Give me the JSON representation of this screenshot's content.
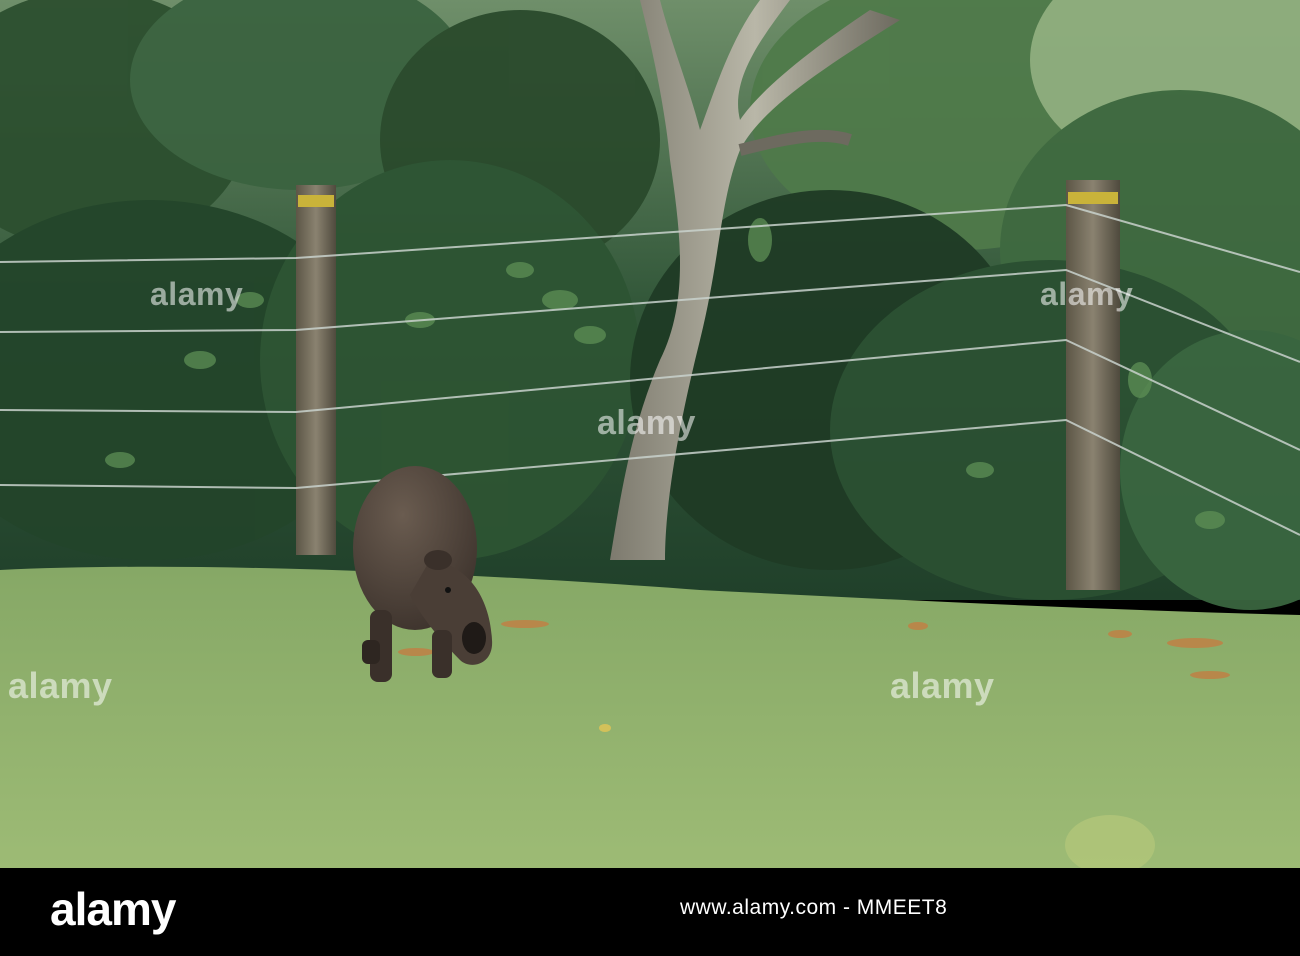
{
  "watermark": {
    "brand": "alamy",
    "overlay_text": "alamy"
  },
  "footer": {
    "logo_text": "alamy",
    "id_text": "www.alamy.com - MMEET8"
  },
  "colors": {
    "lawn": "#8fb06a",
    "foliage": "#2f5a34",
    "capybara": "#4a3e36",
    "footer_bg": "#000000"
  }
}
